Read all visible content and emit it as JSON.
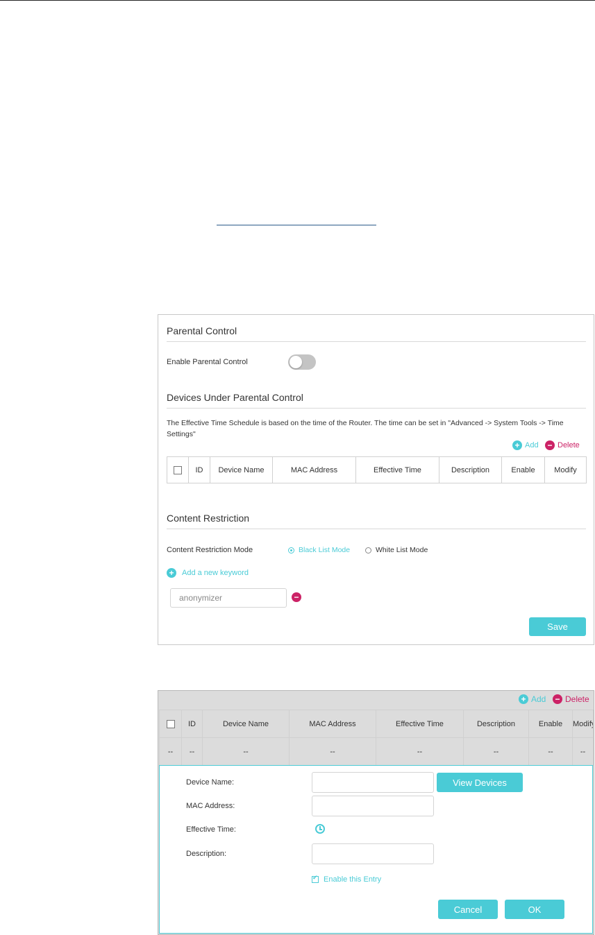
{
  "parental_control": {
    "title": "Parental Control",
    "enable_label": "Enable Parental Control",
    "enabled": false
  },
  "devices_section": {
    "title": "Devices Under Parental Control",
    "note": "The Effective Time Schedule is based on the time of the Router. The time can be set in \"Advanced -> System Tools -> Time Settings\"",
    "add_label": "Add",
    "delete_label": "Delete",
    "columns": [
      "ID",
      "Device Name",
      "MAC Address",
      "Effective Time",
      "Description",
      "Enable",
      "Modify"
    ]
  },
  "content_restriction": {
    "title": "Content Restriction",
    "mode_label": "Content Restriction Mode",
    "modes": [
      "Black List Mode",
      "White List Mode"
    ],
    "selected_mode": "Black List Mode",
    "add_keyword_label": "Add a new keyword",
    "keyword_value": "anonymizer",
    "save_label": "Save"
  },
  "add_device_panel": {
    "add_label": "Add",
    "delete_label": "Delete",
    "columns": [
      "ID",
      "Device Name",
      "MAC Address",
      "Effective Time",
      "Description",
      "Enable",
      "Modify"
    ],
    "row": [
      "--",
      "--",
      "--",
      "--",
      "--",
      "--",
      "--",
      "--"
    ],
    "device_name_label": "Device Name:",
    "mac_label": "MAC Address:",
    "effective_time_label": "Effective Time:",
    "description_label": "Description:",
    "view_devices_label": "View Devices",
    "enable_entry_label": "Enable this Entry",
    "enable_entry_checked": true,
    "cancel_label": "Cancel",
    "ok_label": "OK"
  },
  "colors": {
    "accent": "#4acbd6",
    "delete": "#cc2266"
  },
  "icons": [
    "plus-circle-icon",
    "minus-circle-icon",
    "clock-icon",
    "checkbox-icon"
  ]
}
